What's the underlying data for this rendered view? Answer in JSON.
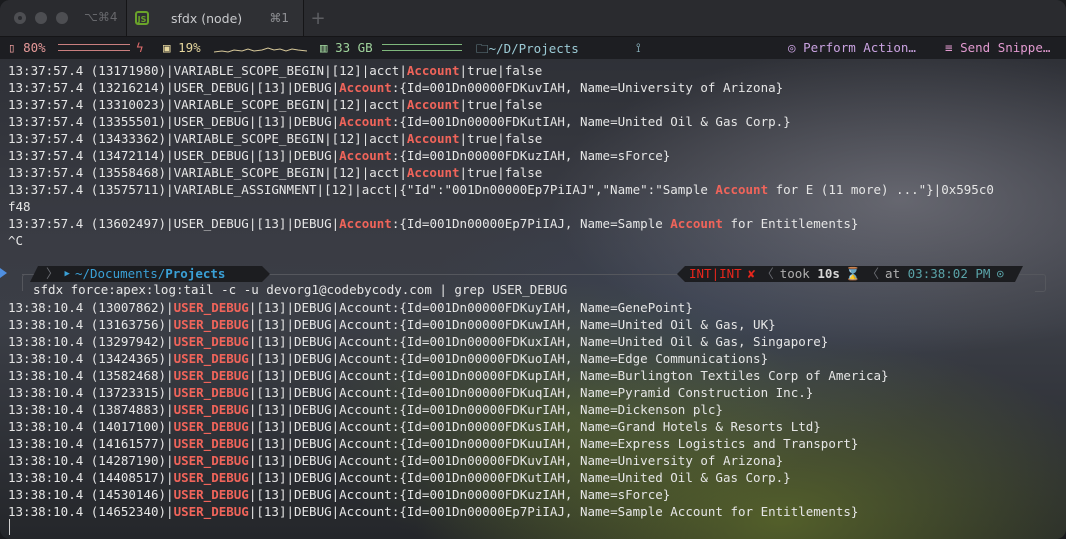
{
  "window": {
    "tabs": [
      {
        "label": "",
        "shortcut": "⌥⌘4",
        "active": false
      },
      {
        "label": "sfdx (node)",
        "shortcut": "⌘1",
        "icon": "nodejs-icon",
        "active": true
      }
    ],
    "new_tab_label": "+"
  },
  "statusbar": {
    "battery": "80%",
    "battery_level": 0.8,
    "cpu": "19%",
    "memory": "33 GB",
    "cwd": "~/D/Projects",
    "git_icon": "⟟",
    "perform_action": "Perform Action…",
    "send_snippet": "Send Snippe…",
    "icons": {
      "battery": "▯",
      "bolt": "ϟ",
      "cpu": "▣",
      "memory": "▥",
      "folder": "🗀",
      "perform": "◎",
      "snippet": "≡"
    }
  },
  "log1": [
    {
      "pre": "13:37:57.4 (13171980)|VARIABLE_SCOPE_BEGIN|[12]|acct|",
      "hl": "Account",
      "post": "|true|false"
    },
    {
      "pre": "13:37:57.4 (13216214)|USER_DEBUG|[13]|DEBUG|",
      "hl": "Account",
      "post": ":{Id=001Dn00000FDKuvIAH, Name=University of Arizona}"
    },
    {
      "pre": "13:37:57.4 (13310023)|VARIABLE_SCOPE_BEGIN|[12]|acct|",
      "hl": "Account",
      "post": "|true|false"
    },
    {
      "pre": "13:37:57.4 (13355501)|USER_DEBUG|[13]|DEBUG|",
      "hl": "Account",
      "post": ":{Id=001Dn00000FDKutIAH, Name=United Oil & Gas Corp.}"
    },
    {
      "pre": "13:37:57.4 (13433362)|VARIABLE_SCOPE_BEGIN|[12]|acct|",
      "hl": "Account",
      "post": "|true|false"
    },
    {
      "pre": "13:37:57.4 (13472114)|USER_DEBUG|[13]|DEBUG|",
      "hl": "Account",
      "post": ":{Id=001Dn00000FDKuzIAH, Name=sForce}"
    },
    {
      "pre": "13:37:57.4 (13558468)|VARIABLE_SCOPE_BEGIN|[12]|acct|",
      "hl": "Account",
      "post": "|true|false"
    },
    {
      "pre": "13:37:57.4 (13575711)|VARIABLE_ASSIGNMENT|[12]|acct|{\"Id\":\"001Dn00000Ep7PiIAJ\",\"Name\":\"Sample ",
      "hl": "Account",
      "post": " for E (11 more) ...\"}|0x595c0"
    },
    {
      "pre": "f48",
      "hl": "",
      "post": ""
    },
    {
      "pre": "13:37:57.4 (13602497)|USER_DEBUG|[13]|DEBUG|",
      "hl": "Account",
      "post": ":{Id=001Dn00000Ep7PiIAJ, Name=Sample "
    },
    {
      "pre": "^C",
      "hl": "",
      "post": ""
    }
  ],
  "log1_tail": {
    "hl": "Account",
    "post": " for Entitlements}"
  },
  "prompt": {
    "apple": "",
    "path_prefix": "~/Documents/",
    "path_current": "Projects",
    "exit_status": "INT|INT",
    "error_mark": "✘",
    "took_label": "took",
    "took_value": "10s",
    "hourglass": "⌛",
    "at_label": "at",
    "time": "03:38:02 PM",
    "clock": "⊙",
    "command": "sfdx force:apex:log:tail -c -u devorg1@codebycody.com | grep USER_DEBUG"
  },
  "log2": [
    {
      "pre": "13:38:10.4 (13007862)|",
      "hl": "USER_DEBUG",
      "post": "|[13]|DEBUG|Account:{Id=001Dn00000FDKuyIAH, Name=GenePoint}"
    },
    {
      "pre": "13:38:10.4 (13163756)|",
      "hl": "USER_DEBUG",
      "post": "|[13]|DEBUG|Account:{Id=001Dn00000FDKuwIAH, Name=United Oil & Gas, UK}"
    },
    {
      "pre": "13:38:10.4 (13297942)|",
      "hl": "USER_DEBUG",
      "post": "|[13]|DEBUG|Account:{Id=001Dn00000FDKuxIAH, Name=United Oil & Gas, Singapore}"
    },
    {
      "pre": "13:38:10.4 (13424365)|",
      "hl": "USER_DEBUG",
      "post": "|[13]|DEBUG|Account:{Id=001Dn00000FDKuoIAH, Name=Edge Communications}"
    },
    {
      "pre": "13:38:10.4 (13582468)|",
      "hl": "USER_DEBUG",
      "post": "|[13]|DEBUG|Account:{Id=001Dn00000FDKupIAH, Name=Burlington Textiles Corp of America}"
    },
    {
      "pre": "13:38:10.4 (13723315)|",
      "hl": "USER_DEBUG",
      "post": "|[13]|DEBUG|Account:{Id=001Dn00000FDKuqIAH, Name=Pyramid Construction Inc.}"
    },
    {
      "pre": "13:38:10.4 (13874883)|",
      "hl": "USER_DEBUG",
      "post": "|[13]|DEBUG|Account:{Id=001Dn00000FDKurIAH, Name=Dickenson plc}"
    },
    {
      "pre": "13:38:10.4 (14017100)|",
      "hl": "USER_DEBUG",
      "post": "|[13]|DEBUG|Account:{Id=001Dn00000FDKusIAH, Name=Grand Hotels & Resorts Ltd}"
    },
    {
      "pre": "13:38:10.4 (14161577)|",
      "hl": "USER_DEBUG",
      "post": "|[13]|DEBUG|Account:{Id=001Dn00000FDKuuIAH, Name=Express Logistics and Transport}"
    },
    {
      "pre": "13:38:10.4 (14287190)|",
      "hl": "USER_DEBUG",
      "post": "|[13]|DEBUG|Account:{Id=001Dn00000FDKuvIAH, Name=University of Arizona}"
    },
    {
      "pre": "13:38:10.4 (14408517)|",
      "hl": "USER_DEBUG",
      "post": "|[13]|DEBUG|Account:{Id=001Dn00000FDKutIAH, Name=United Oil & Gas Corp.}"
    },
    {
      "pre": "13:38:10.4 (14530146)|",
      "hl": "USER_DEBUG",
      "post": "|[13]|DEBUG|Account:{Id=001Dn00000FDKuzIAH, Name=sForce}"
    },
    {
      "pre": "13:38:10.4 (14652340)|",
      "hl": "USER_DEBUG",
      "post": "|[13]|DEBUG|Account:{Id=001Dn00000Ep7PiIAJ, Name=Sample Account for Entitlements}"
    }
  ],
  "colors": {
    "highlight": "#f0645a",
    "path": "#3aa0d6",
    "time": "#5aa3a8",
    "error": "#e8261c"
  }
}
